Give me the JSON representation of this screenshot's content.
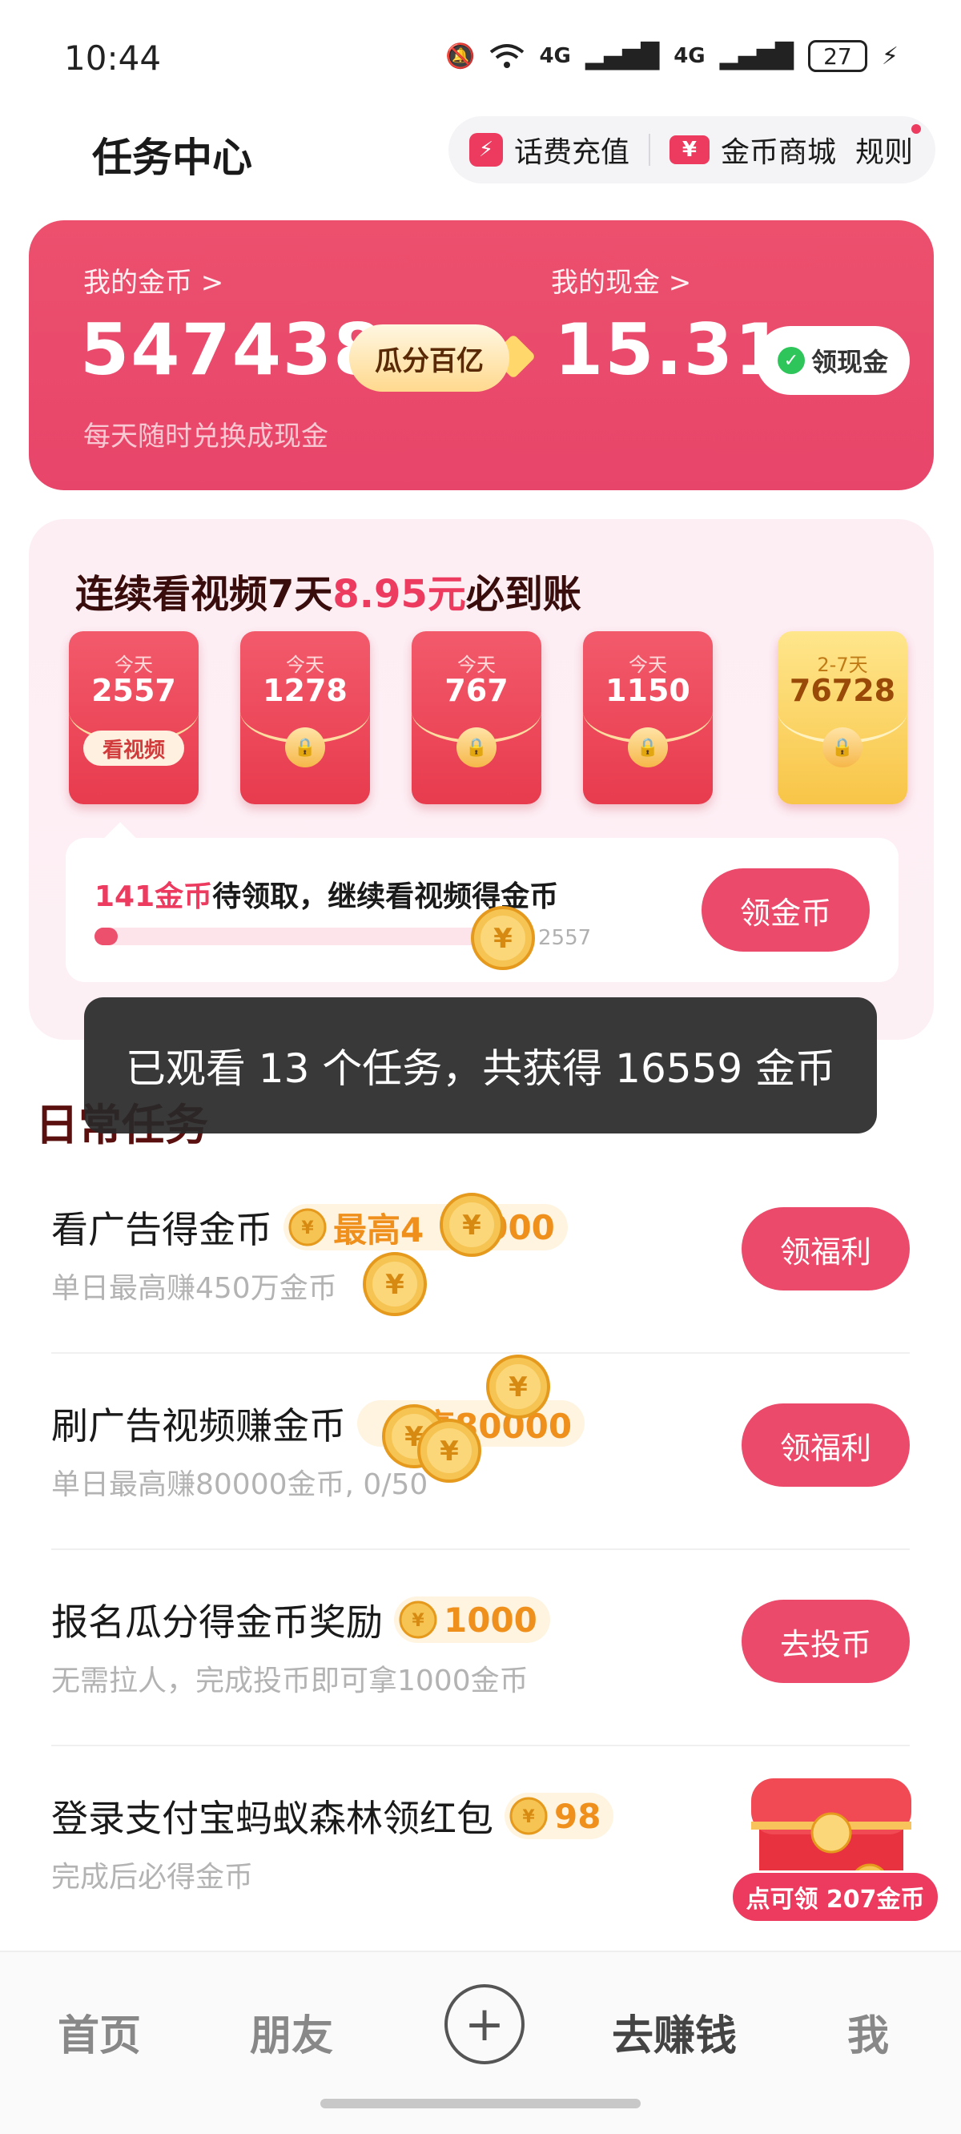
{
  "status_bar": {
    "time": "10:44",
    "signal_label": "4G",
    "battery": "27"
  },
  "header": {
    "title": "任务中心",
    "recharge_icon_glyph": "⚡",
    "recharge_label": "话费充值",
    "mall_icon_glyph": "¥",
    "mall_label": "金币商城",
    "rules_label": "规则"
  },
  "coin_card": {
    "coins_label": "我的金币 >",
    "coins_value": "547438",
    "coins_sub": "每天随时兑换成现金",
    "guafen_label": "瓜分百亿",
    "cash_label": "我的现金 >",
    "cash_value": "15.31",
    "withdraw_label": "领现金"
  },
  "video_streak": {
    "title_prefix": "连续看视频7天",
    "title_amount": "8.95元",
    "title_suffix": "必到账",
    "envelopes": [
      {
        "day": "今天",
        "value": "2557",
        "tag": "看视频"
      },
      {
        "day": "今天",
        "value": "1278"
      },
      {
        "day": "今天",
        "value": "767"
      },
      {
        "day": "今天",
        "value": "1150"
      },
      {
        "day": "2-7天",
        "value": "76728"
      }
    ],
    "claim_amount": "141金币",
    "claim_text": "待领取，继续看视频得金币",
    "progress_target": "2557",
    "progress_fraction": 0.055,
    "claim_button": "领金币"
  },
  "toast": {
    "text": "已观看 13 个任务，共获得 16559 金币"
  },
  "daily_tasks": {
    "title": "日常任务",
    "items": [
      {
        "title": "看广告得金币",
        "reward": "最高4",
        "reward_tail": "000",
        "sub": "单日最高赚450万金币",
        "button": "领福利"
      },
      {
        "title": "刷广告视频赚金币",
        "reward": "高80000",
        "sub": "单日最高赚80000金币, 0/50",
        "button": "领福利"
      },
      {
        "title": "报名瓜分得金币奖励",
        "reward": "1000",
        "sub": "无需拉人，完成投币即可拿1000金币",
        "button": "去投币"
      },
      {
        "title": "登录支付宝蚂蚁森林领红包",
        "reward": "98",
        "sub": "完成后必得金币",
        "button": ""
      }
    ]
  },
  "promo": {
    "label": "点可领 207金币"
  },
  "bottom_nav": {
    "home": "首页",
    "friends": "朋友",
    "plus": "+",
    "earn": "去赚钱",
    "me": "我"
  }
}
